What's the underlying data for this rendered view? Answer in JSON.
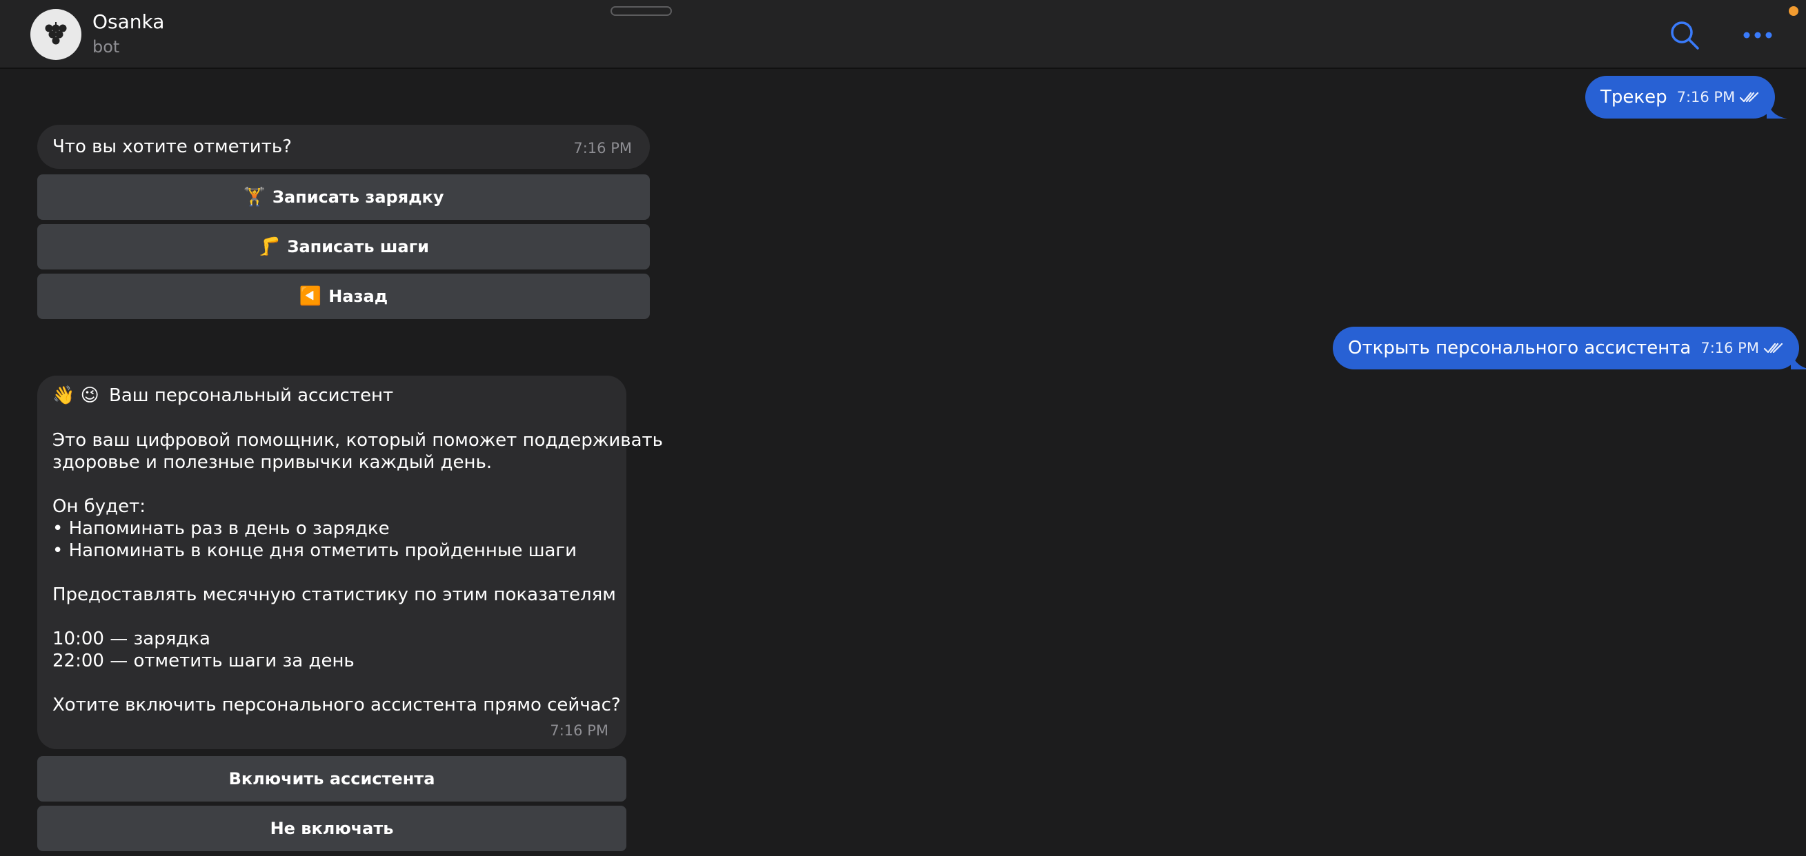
{
  "header": {
    "title": "Osanka",
    "subtitle": "bot"
  },
  "messages": {
    "out_1": {
      "text": "Трекер",
      "time": "7:16 PM"
    },
    "in_1": {
      "text": "Что вы хотите отметить?",
      "time": "7:16 PM"
    },
    "keyboard_1": [
      {
        "emoji": "🏋",
        "label": "Записать зарядку"
      },
      {
        "emoji": "🦵",
        "label": "Записать шаги"
      },
      {
        "emoji": "◀️",
        "label": "Назад"
      }
    ],
    "out_2": {
      "text": "Открыть персонального ассистента",
      "time": "7:16 PM"
    },
    "in_2": {
      "emoji_line": "👋 😉",
      "title": "Ваш персональный ассистент",
      "p1_l1": "Это ваш цифровой помощник, который поможет поддерживать",
      "p1_l2": "здоровье и полезные привычки каждый день.",
      "p2_l1": "Он будет:",
      "p2_l2": "• Напоминать раз в день о зарядке",
      "p2_l3": "• Напоминать в конце дня отметить пройденные шаги",
      "p3": "Предоставлять месячную статистику по этим показателям",
      "p4_l1": "10:00 — зарядка",
      "p4_l2": "22:00 — отметить шаги за день",
      "p5": "Хотите включить персонального ассистента прямо сейчас?",
      "time": "7:16 PM"
    },
    "keyboard_2": [
      {
        "label": "Включить ассистента"
      },
      {
        "label": "Не включать"
      }
    ]
  },
  "colors": {
    "outgoing_bubble": "#2861d4",
    "incoming_bubble": "#2c2c2e",
    "keyboard_button": "#3e4044",
    "accent": "#3a7bfa",
    "notification_dot": "#f29b30"
  },
  "icons": {
    "avatar": "grape-logo-icon",
    "search": "search-icon",
    "more": "more-horizontal-icon",
    "read_status": "double-check-icon"
  }
}
